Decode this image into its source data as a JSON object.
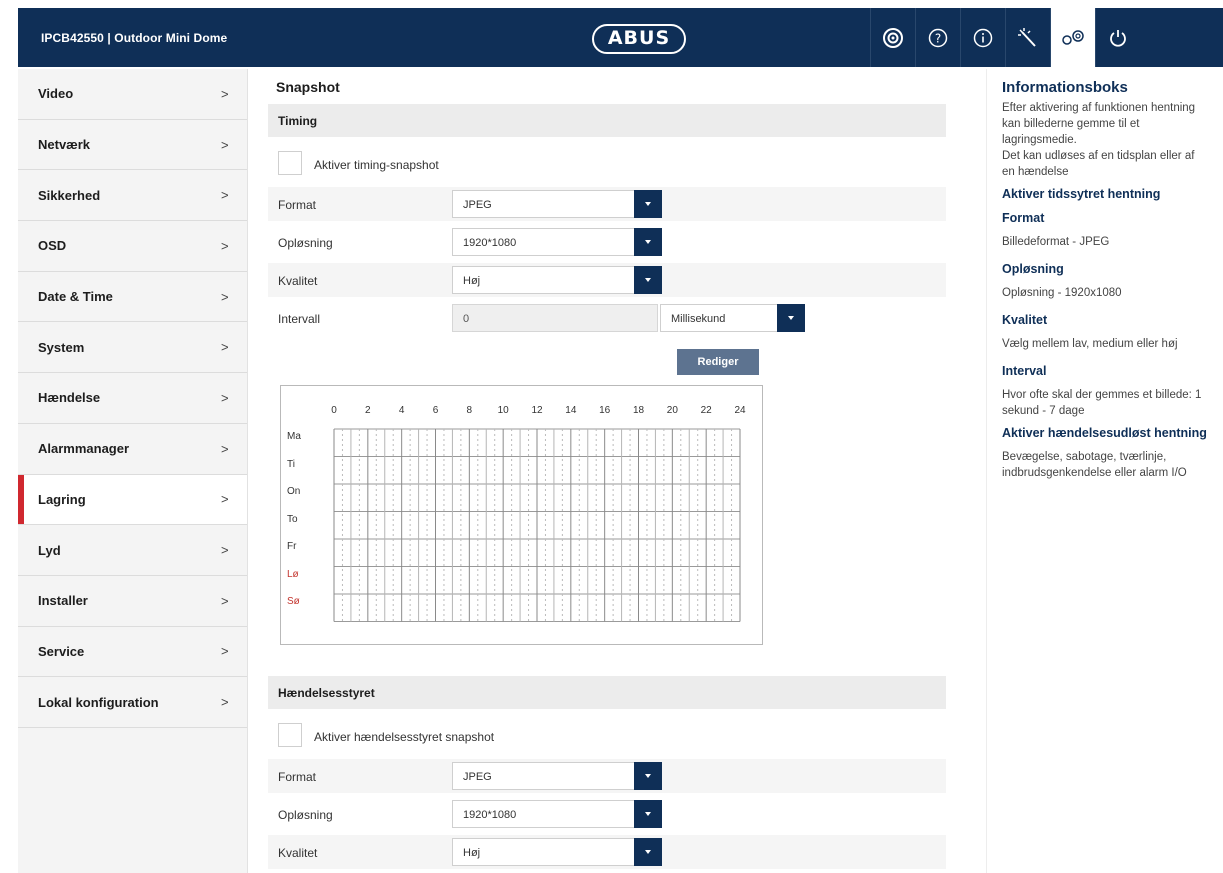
{
  "header": {
    "device_title": "IPCB42550  |  Outdoor Mini Dome",
    "logo": "ABUS",
    "icons": [
      "camera-icon",
      "help-icon",
      "info-icon",
      "wizard-icon",
      "settings-icon",
      "power-icon"
    ],
    "active_icon": "settings-icon",
    "color_primary": "#0f2f57"
  },
  "sidebar": {
    "active_item": "Lagring",
    "accent_color": "#d0282f",
    "chevron": ">",
    "items": [
      {
        "label": "Video"
      },
      {
        "label": "Netværk"
      },
      {
        "label": "Sikkerhed"
      },
      {
        "label": "OSD"
      },
      {
        "label": "Date & Time"
      },
      {
        "label": "System"
      },
      {
        "label": "Hændelse"
      },
      {
        "label": "Alarmmanager"
      },
      {
        "label": "Lagring"
      },
      {
        "label": "Lyd"
      },
      {
        "label": "Installer"
      },
      {
        "label": "Service"
      },
      {
        "label": "Lokal konfiguration"
      }
    ]
  },
  "main": {
    "title": "Snapshot",
    "timing": {
      "section_label": "Timing",
      "enable_label": "Aktiver timing-snapshot",
      "enabled": false,
      "format_label": "Format",
      "format_value": "JPEG",
      "resolution_label": "Opløsning",
      "resolution_value": "1920*1080",
      "quality_label": "Kvalitet",
      "quality_value": "Høj",
      "interval_label": "Intervall",
      "interval_value": "0",
      "interval_unit": "Millisekund",
      "edit_button": "Rediger"
    },
    "schedule": {
      "hours": [
        "0",
        "2",
        "4",
        "6",
        "8",
        "10",
        "12",
        "14",
        "16",
        "18",
        "20",
        "22",
        "24"
      ],
      "days": [
        "Ma",
        "Ti",
        "On",
        "To",
        "Fr",
        "Lø",
        "Sø"
      ],
      "weekend_color": "#c4362f"
    },
    "event": {
      "section_label": "Hændelsesstyret",
      "enable_label": "Aktiver hændelsesstyret snapshot",
      "enabled": false,
      "format_label": "Format",
      "format_value": "JPEG",
      "resolution_label": "Opløsning",
      "resolution_value": "1920*1080",
      "quality_label": "Kvalitet",
      "quality_value": "Høj"
    }
  },
  "info": {
    "title": "Informationsboks",
    "intro": "Efter aktivering af funktionen hentning kan billederne gemme til et lagringsmedie.",
    "intro2": "Det kan udløses af en tidsplan eller af en hændelse",
    "h_timed": "Aktiver tidssytret hentning",
    "h_format": "Format",
    "p_format": "Billedeformat - JPEG",
    "h_resolution": "Opløsning",
    "p_resolution": "Opløsning - 1920x1080",
    "h_quality": "Kvalitet",
    "p_quality": "Vælg mellem lav, medium eller høj",
    "h_interval": "Interval",
    "p_interval": "Hvor ofte skal der gemmes et billede: 1 sekund - 7 dage",
    "h_event": "Aktiver hændelsesudløst hentning",
    "p_event": "Bevægelse, sabotage, tværlinje, indbrudsgenkendelse eller alarm I/O"
  }
}
